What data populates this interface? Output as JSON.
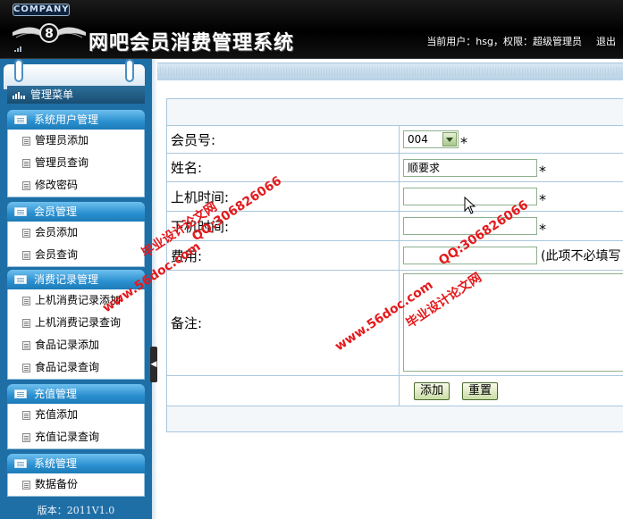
{
  "header": {
    "company_badge": "COMPANY",
    "title": "网吧会员消费管理系统",
    "user_info": "当前用户：hsg，权限：超级管理员",
    "logout": "退出"
  },
  "sidebar": {
    "menu_title": "管理菜单",
    "groups": [
      {
        "title": "系统用户管理",
        "items": [
          "管理员添加",
          "管理员查询",
          "修改密码"
        ]
      },
      {
        "title": "会员管理",
        "items": [
          "会员添加",
          "会员查询"
        ]
      },
      {
        "title": "消费记录管理",
        "items": [
          "上机消费记录添加",
          "上机消费记录查询",
          "食品记录添加",
          "食品记录查询"
        ]
      },
      {
        "title": "充值管理",
        "items": [
          "充值添加",
          "充值记录查询"
        ]
      },
      {
        "title": "系统管理",
        "items": [
          "数据备份"
        ]
      }
    ],
    "version": "版本：2011V1.0",
    "collapse_glyph": "◀"
  },
  "form": {
    "fields": {
      "member_no": {
        "label": "会员号:",
        "value": "004",
        "required_mark": "*"
      },
      "name": {
        "label": "姓名:",
        "value": "顺要求",
        "required_mark": "*"
      },
      "login_time": {
        "label": "上机时间:",
        "value": "",
        "required_mark": "*"
      },
      "logout_time": {
        "label": "下机时间:",
        "value": "",
        "required_mark": "*"
      },
      "fee": {
        "label": "费用:",
        "value": "",
        "note": "(此项不必填写"
      },
      "remarks": {
        "label": "备注:",
        "value": ""
      }
    },
    "buttons": {
      "add": "添加",
      "reset": "重置"
    }
  },
  "watermarks": {
    "site_a": "毕业设计论文网",
    "url_a": "www.56doc.com",
    "qq_a": "QQ:306826066",
    "site_b": "毕业设计论文网",
    "url_b": "www.56doc.com",
    "qq_b": "QQ:306826066"
  },
  "colors": {
    "sidebar_bg": "#1f6fa7",
    "group_title": "#2a8fcf",
    "watermark": "#e4191c",
    "header_bg": "#000000"
  },
  "icons": [
    "logo-emblem-icon",
    "menu-bars-icon",
    "group-list-icon",
    "item-page-icon",
    "select-arrow-icon",
    "mouse-cursor-icon"
  ]
}
